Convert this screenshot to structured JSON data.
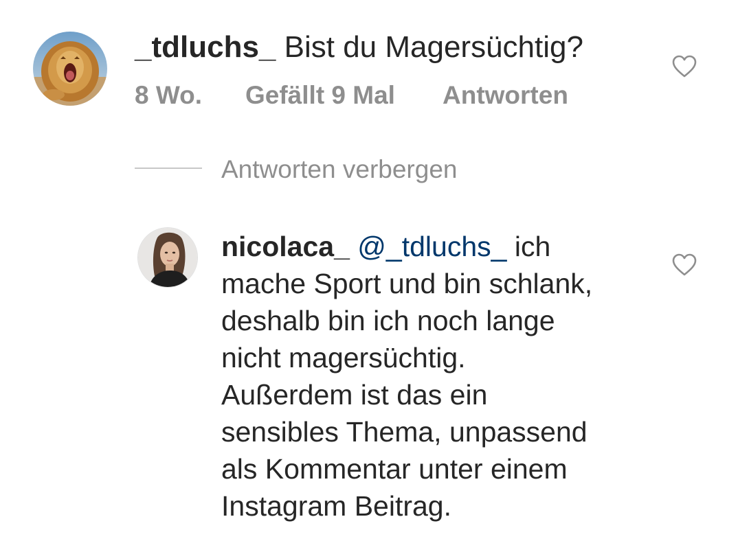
{
  "comment": {
    "username": "_tdluchs_",
    "text": "Bist du Magersüchtig?",
    "age": "8 Wo.",
    "likes": "Gefällt 9 Mal",
    "reply_label": "Antworten",
    "avatar_icon": "lion-avatar"
  },
  "hide_replies_label": "Antworten verbergen",
  "reply": {
    "username": "nicolaca_",
    "mention": "@_tdluchs_",
    "first_line_rest": "ich",
    "lines": [
      "mache Sport und bin schlank,",
      "deshalb bin ich noch lange",
      "nicht magersüchtig.",
      "Außerdem ist das ein",
      "sensibles Thema, unpassend",
      "als Kommentar unter einem",
      "Instagram Beitrag."
    ],
    "avatar_icon": "woman-portrait-avatar"
  },
  "icons": {
    "like": "heart-outline-icon"
  },
  "colors": {
    "text": "#262626",
    "secondary": "#8e8e8e",
    "mention": "#00376b",
    "divider": "#c7c7c7"
  }
}
